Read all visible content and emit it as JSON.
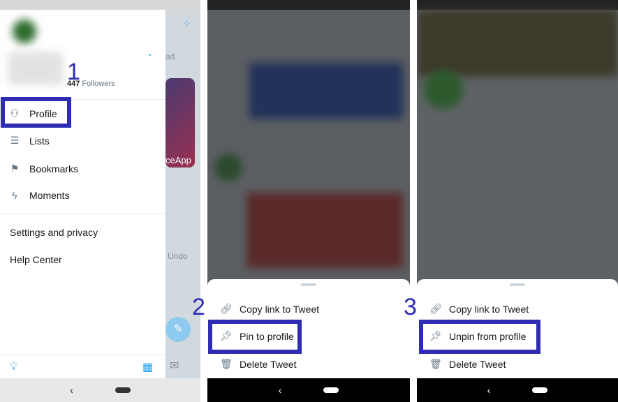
{
  "panel1": {
    "followers_count": "447",
    "followers_label": "Followers",
    "step": "1",
    "menu": [
      {
        "label": "Profile",
        "icon": "person-icon"
      },
      {
        "label": "Lists",
        "icon": "list-icon"
      },
      {
        "label": "Bookmarks",
        "icon": "bookmark-icon"
      },
      {
        "label": "Moments",
        "icon": "lightning-icon"
      }
    ],
    "settings": "Settings and privacy",
    "help": "Help Center",
    "bg_text_1": "ad.",
    "bg_text_2": "ceApp",
    "bg_text_3": "Undo"
  },
  "panel2": {
    "step": "2",
    "items": [
      {
        "label": "Copy link to Tweet",
        "icon": "link-icon"
      },
      {
        "label": "Pin to profile",
        "icon": "pin-icon"
      },
      {
        "label": "Delete Tweet",
        "icon": "trash-icon"
      }
    ]
  },
  "panel3": {
    "step": "3",
    "items": [
      {
        "label": "Copy link to Tweet",
        "icon": "link-icon"
      },
      {
        "label": "Unpin from profile",
        "icon": "pin-icon"
      },
      {
        "label": "Delete Tweet",
        "icon": "trash-icon"
      }
    ]
  },
  "colors": {
    "highlight": "#2d2cb3",
    "twitter_blue": "#1da1f2"
  }
}
